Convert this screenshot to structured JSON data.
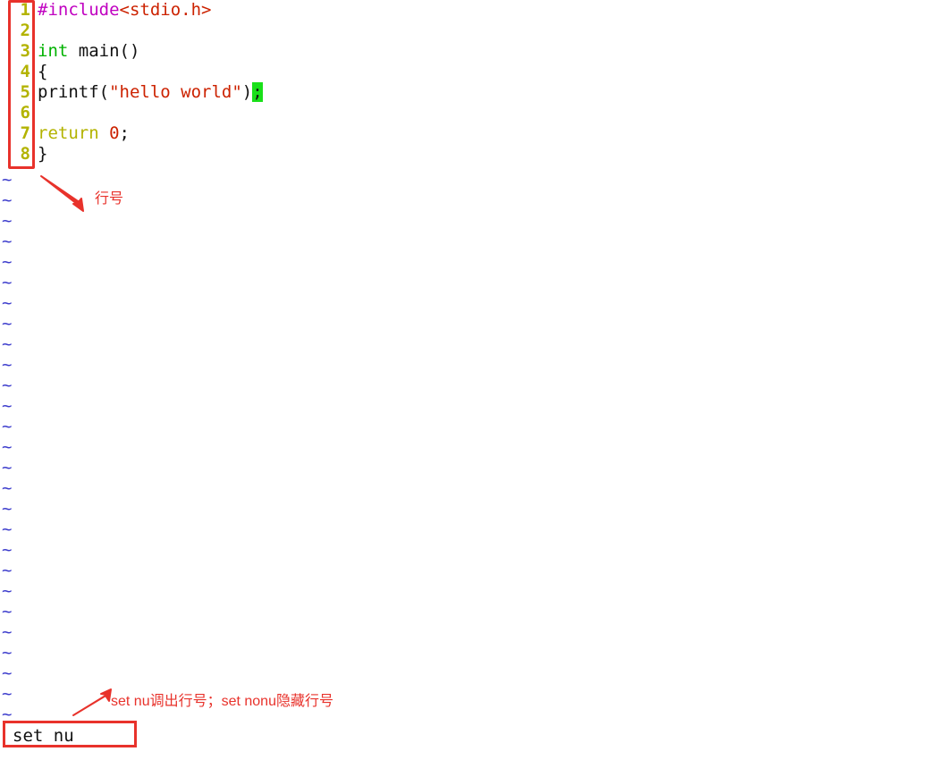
{
  "editor": {
    "app": "vim",
    "mode_line_value": "set nu",
    "gutter_color": "#b3b300",
    "tilde_color": "#3b3bcc",
    "cursor_bg": "#19e019",
    "annotation_color": "#e8322b",
    "code_lines": [
      {
        "number": "1",
        "tokens": [
          {
            "text": "#include",
            "kind": "preproc"
          },
          {
            "text": "<stdio.h>",
            "kind": "header"
          }
        ]
      },
      {
        "number": "2",
        "tokens": []
      },
      {
        "number": "3",
        "tokens": [
          {
            "text": "int",
            "kind": "type"
          },
          {
            "text": " main()",
            "kind": "plain"
          }
        ]
      },
      {
        "number": "4",
        "tokens": [
          {
            "text": "{",
            "kind": "plain"
          }
        ]
      },
      {
        "number": "5",
        "tokens": [
          {
            "text": "printf(",
            "kind": "plain"
          },
          {
            "text": "\"hello world\"",
            "kind": "string"
          },
          {
            "text": ")",
            "kind": "plain"
          },
          {
            "text": ";",
            "kind": "cursor"
          }
        ]
      },
      {
        "number": "6",
        "tokens": []
      },
      {
        "number": "7",
        "tokens": [
          {
            "text": "return",
            "kind": "keyword"
          },
          {
            "text": " ",
            "kind": "plain"
          },
          {
            "text": "0",
            "kind": "number"
          },
          {
            "text": ";",
            "kind": "plain"
          }
        ]
      },
      {
        "number": "8",
        "tokens": [
          {
            "text": "}",
            "kind": "plain"
          }
        ]
      }
    ],
    "tilde_glyph": "~",
    "tilde_count": 27
  },
  "annotations": {
    "line_number_label": "行号",
    "command_hint_label": "set nu调出行号；set nonu隐藏行号"
  }
}
